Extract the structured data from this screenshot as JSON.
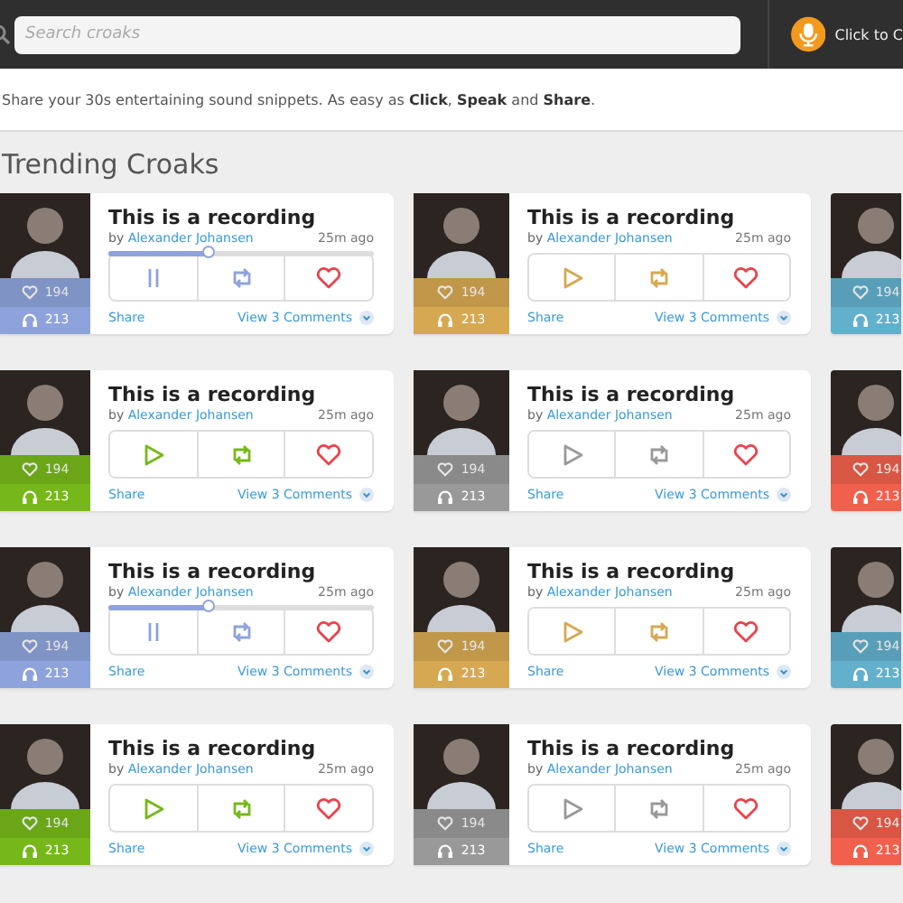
{
  "header": {
    "search": {
      "placeholder": "Search croaks"
    },
    "record_button": {
      "label": "Click to C"
    }
  },
  "tagline": "Share your 30s entertaining sound snippets. As easy as **Click**, **Speak** and **Share**.",
  "section_title": "Trending Croaks",
  "cards": [
    {
      "kind": "full",
      "color": "#8ea3db",
      "likes": "194",
      "listens": "213",
      "title": "This is a recording",
      "by": "by",
      "author": "Alexander Johansen",
      "time": "25m ago",
      "playing": true,
      "level": 0.38,
      "share": "Share",
      "comments": "View 3 Comments"
    },
    {
      "kind": "full",
      "color": "#d6a852",
      "likes": "194",
      "listens": "213",
      "title": "This is a recording",
      "by": "by",
      "author": "Alexander Johansen",
      "time": "25m ago",
      "playing": false,
      "share": "Share",
      "comments": "View 3 Comments"
    },
    {
      "kind": "clipped",
      "color": "#62b0cc",
      "likes": "194",
      "listens": "213"
    },
    {
      "kind": "full",
      "color": "#76b81a",
      "likes": "194",
      "listens": "213",
      "title": "This is a recording",
      "by": "by",
      "author": "Alexander Johansen",
      "time": "25m ago",
      "playing": false,
      "share": "Share",
      "comments": "View 3 Comments"
    },
    {
      "kind": "full",
      "color": "#999999",
      "likes": "194",
      "listens": "213",
      "title": "This is a recording",
      "by": "by",
      "author": "Alexander Johansen",
      "time": "25m ago",
      "playing": false,
      "share": "Share",
      "comments": "View 3 Comments"
    },
    {
      "kind": "clipped",
      "color": "#f0604c",
      "likes": "194",
      "listens": "213"
    },
    {
      "kind": "full",
      "color": "#8ea3db",
      "likes": "194",
      "listens": "213",
      "title": "This is a recording",
      "by": "by",
      "author": "Alexander Johansen",
      "time": "25m ago",
      "playing": true,
      "level": 0.38,
      "share": "Share",
      "comments": "View 3 Comments"
    },
    {
      "kind": "full",
      "color": "#d6a852",
      "likes": "194",
      "listens": "213",
      "title": "This is a recording",
      "by": "by",
      "author": "Alexander Johansen",
      "time": "25m ago",
      "playing": false,
      "share": "Share",
      "comments": "View 3 Comments"
    },
    {
      "kind": "clipped",
      "color": "#62b0cc",
      "likes": "194",
      "listens": "213"
    },
    {
      "kind": "full",
      "color": "#76b81a",
      "likes": "194",
      "listens": "213",
      "title": "This is a recording",
      "by": "by",
      "author": "Alexander Johansen",
      "time": "25m ago",
      "playing": false,
      "share": "Share",
      "comments": "View 3 Comments"
    },
    {
      "kind": "full",
      "color": "#999999",
      "likes": "194",
      "listens": "213",
      "title": "This is a recording",
      "by": "by",
      "author": "Alexander Johansen",
      "time": "25m ago",
      "playing": false,
      "share": "Share",
      "comments": "View 3 Comments"
    },
    {
      "kind": "clipped",
      "color": "#f0604c",
      "likes": "194",
      "listens": "213"
    }
  ]
}
